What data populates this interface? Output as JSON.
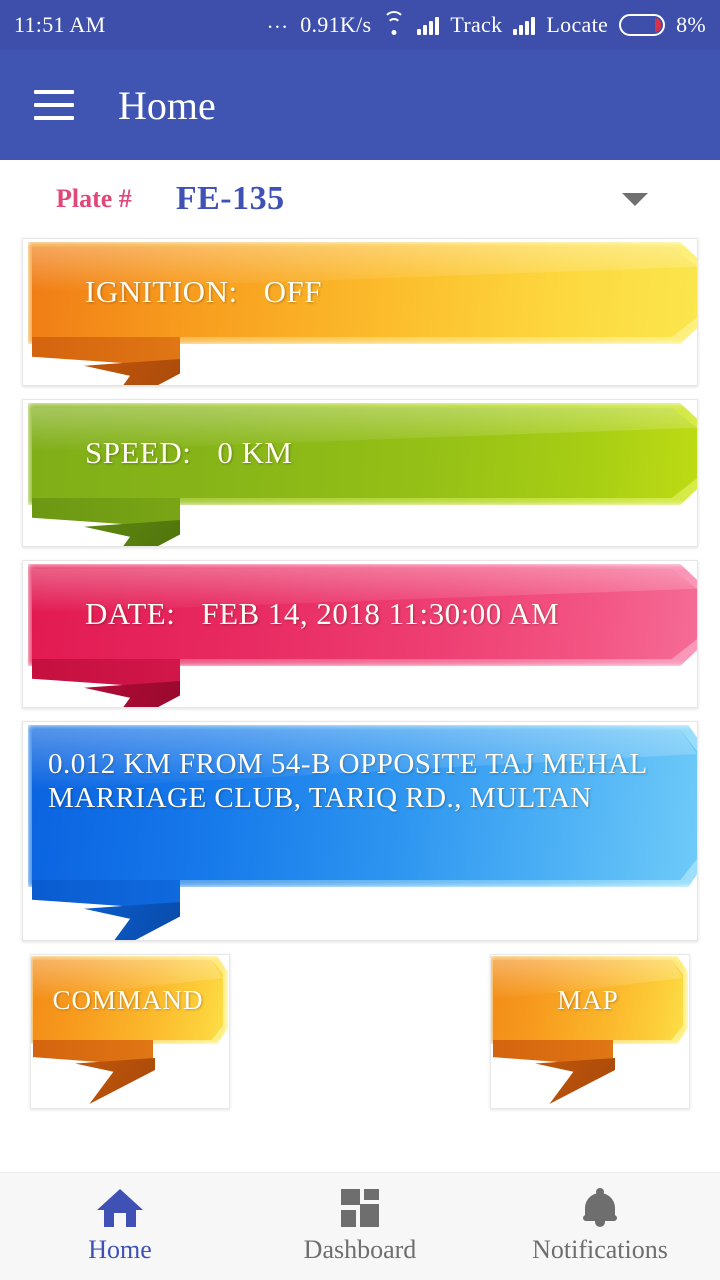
{
  "status_bar": {
    "time": "11:51 AM",
    "overflow_dots": "...",
    "network_speed": "0.91K/s",
    "wifi_icon": "wifi-icon",
    "sim1_signal_icon": "signal-bars-icon",
    "carrier1": "Track",
    "sim2_signal_icon": "signal-bars-icon",
    "carrier2": "Locate",
    "battery_icon": "battery-icon",
    "battery_percent": "8%",
    "background_color": "#3d4fab"
  },
  "app_bar": {
    "menu_icon": "hamburger-menu-icon",
    "title": "Home",
    "background_color": "#4054b2"
  },
  "plate_selector": {
    "label": "Plate #",
    "value": "FE-135",
    "caret_icon": "chevron-down-icon",
    "label_color": "#e0487a",
    "value_color": "#3f51b5"
  },
  "cards": [
    {
      "name": "ignition",
      "label": "IGNITION:",
      "value": "OFF",
      "color": "#f7a11d"
    },
    {
      "name": "speed",
      "label": "SPEED:",
      "value": "0 KM",
      "color": "#95c016"
    },
    {
      "name": "date",
      "label": "DATE:",
      "value": "FEB 14, 2018   11:30:00 AM",
      "color": "#ee3f73"
    },
    {
      "name": "location",
      "label": "",
      "value": "0.012 KM FROM 54-B OPPOSITE TAJ MEHAL MARRIAGE CLUB, TARIQ RD., MULTAN",
      "color": "#2d95f0"
    }
  ],
  "buttons": {
    "command": "COMMAND",
    "map": "MAP",
    "color": "#fbb62b"
  },
  "bottom_nav": {
    "items": [
      {
        "label": "Home",
        "icon": "home-icon",
        "active": true
      },
      {
        "label": "Dashboard",
        "icon": "grid-icon",
        "active": false
      },
      {
        "label": "Notifications",
        "icon": "bell-icon",
        "active": false
      }
    ],
    "active_color": "#3f51b5",
    "inactive_color": "#6e6e6e"
  }
}
